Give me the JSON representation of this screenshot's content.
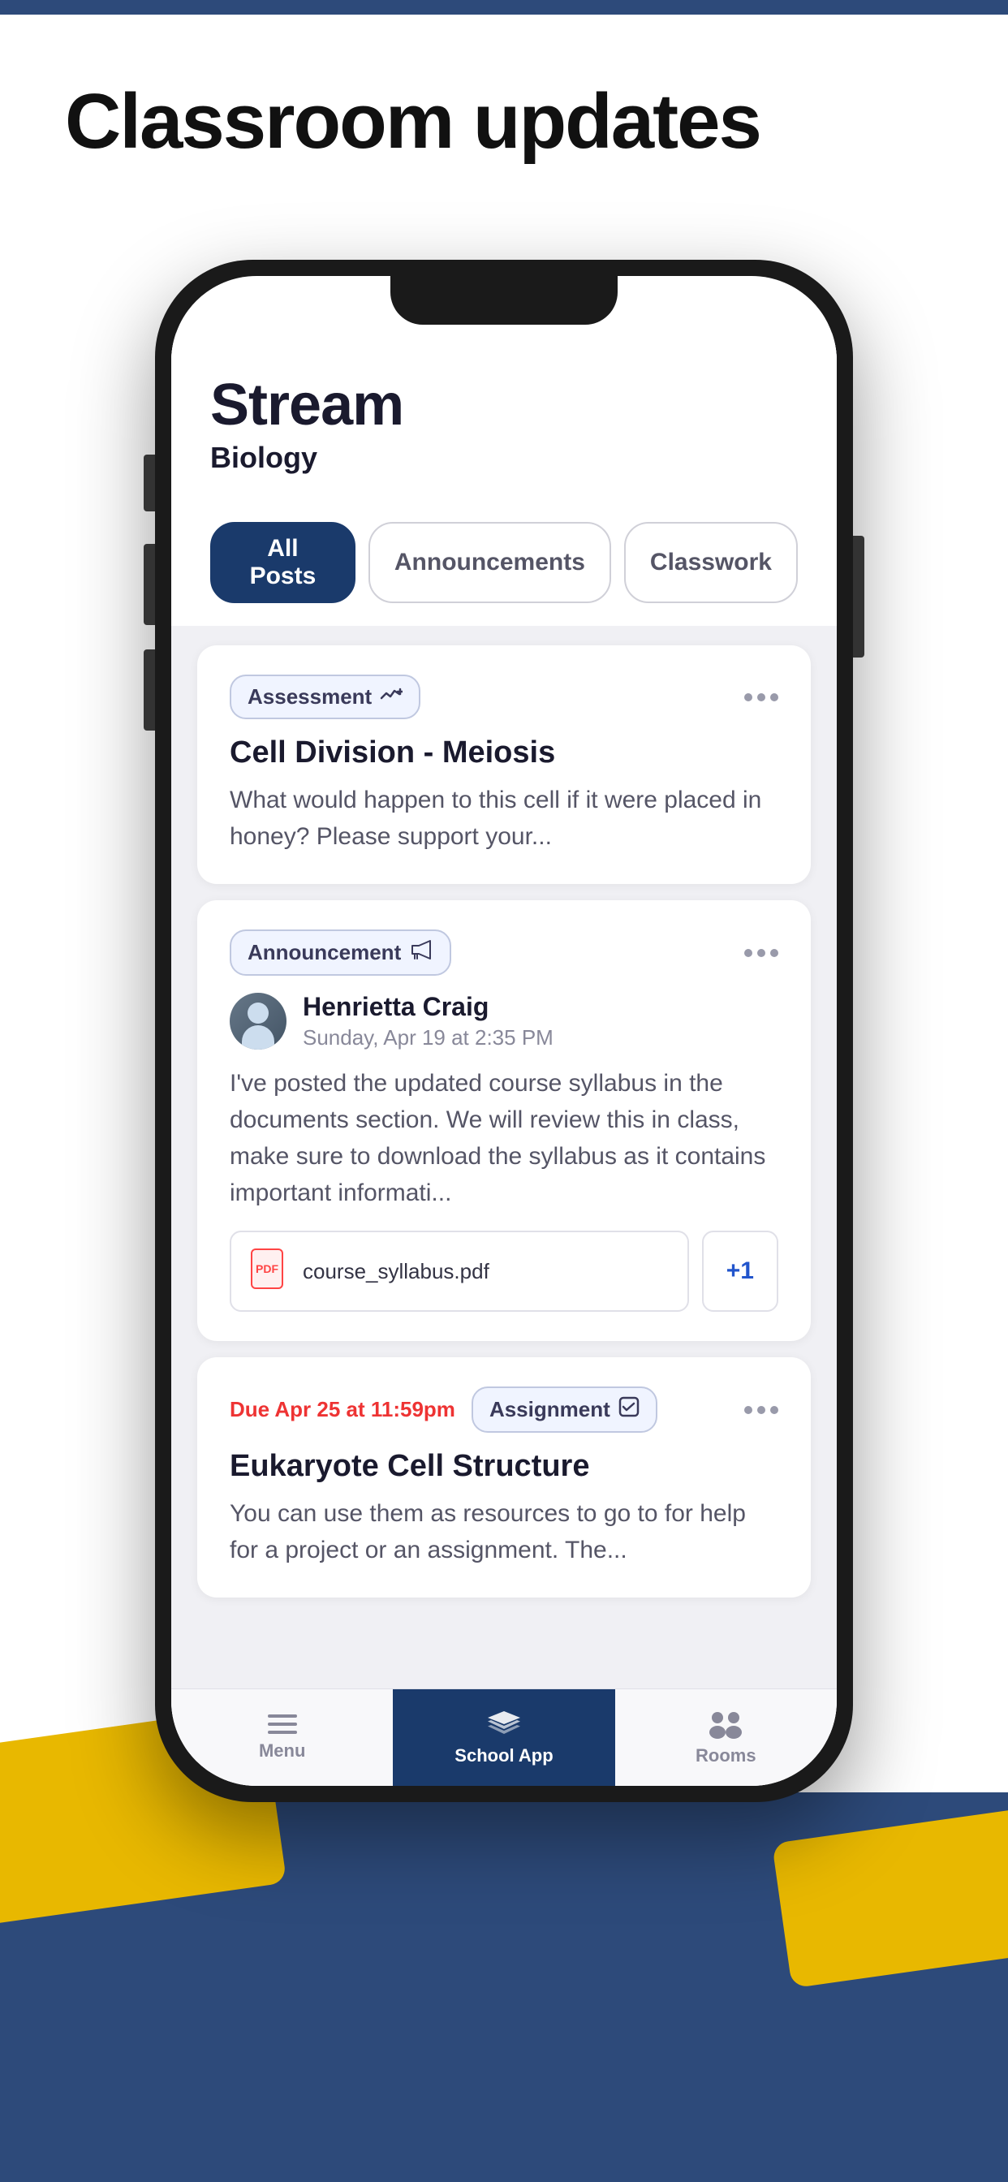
{
  "page": {
    "title": "Classroom updates",
    "bg_top_bar_color": "#2d4a7a",
    "bg_color": "#ffffff",
    "bottom_bg_color": "#2d4a7a",
    "accent_color": "#e8b800"
  },
  "stream": {
    "title": "Stream",
    "subtitle": "Biology"
  },
  "filter_tabs": {
    "items": [
      {
        "label": "All Posts",
        "active": true
      },
      {
        "label": "Announcements",
        "active": false
      },
      {
        "label": "Classwork",
        "active": false
      }
    ]
  },
  "cards": [
    {
      "type": "assessment",
      "tag_label": "Assessment",
      "title": "Cell Division - Meiosis",
      "body": "What would happen to this cell if it were placed in honey? Please support your..."
    },
    {
      "type": "announcement",
      "tag_label": "Announcement",
      "author_name": "Henrietta Craig",
      "author_date": "Sunday, Apr 19 at 2:35 PM",
      "body": "I've posted the updated course syllabus in the documents section. We will review this in class, make sure to download the syllabus as it contains important informati...",
      "attachment_name": "course_syllabus.pdf",
      "attachment_count": "+1"
    },
    {
      "type": "assignment",
      "due_label": "Due Apr 25 at 11:59pm",
      "tag_label": "Assignment",
      "title": "Eukaryote Cell Structure",
      "body": "You can use them as resources to go to for help for a project or an assignment. The..."
    }
  ],
  "bottom_nav": {
    "items": [
      {
        "label": "Menu",
        "type": "menu",
        "active": false
      },
      {
        "label": "School App",
        "type": "schoolapp",
        "active": true
      },
      {
        "label": "Rooms",
        "type": "rooms",
        "active": false
      }
    ]
  }
}
